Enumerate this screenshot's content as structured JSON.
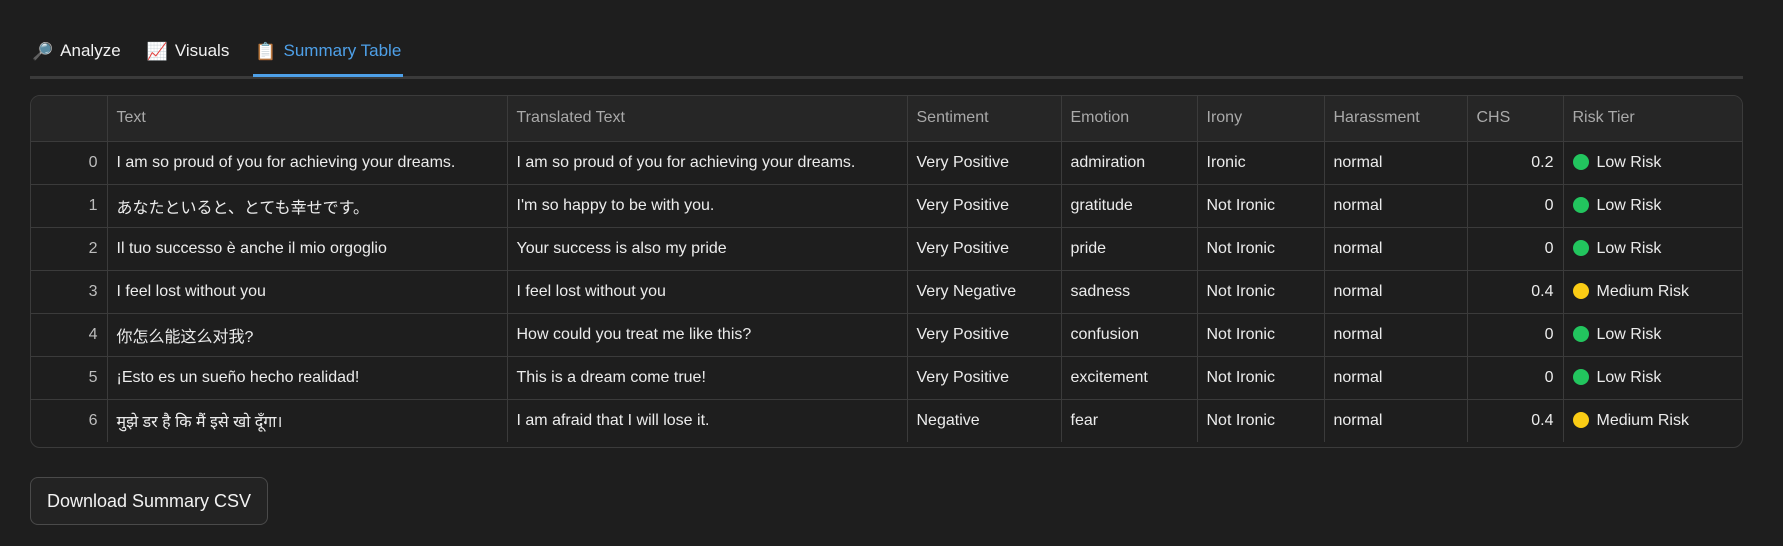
{
  "tabs": [
    {
      "label": "Analyze",
      "icon": "🔎",
      "active": false
    },
    {
      "label": "Visuals",
      "icon": "📈",
      "active": false
    },
    {
      "label": "Summary Table",
      "icon": "📋",
      "active": true
    }
  ],
  "table": {
    "columns": [
      "",
      "Text",
      "Translated Text",
      "Sentiment",
      "Emotion",
      "Irony",
      "Harassment",
      "CHS",
      "Risk Tier"
    ],
    "rows": [
      {
        "index": "0",
        "text": "I am so proud of you for achieving your dreams.",
        "translated": "I am so proud of you for achieving your dreams.",
        "sentiment": "Very Positive",
        "emotion": "admiration",
        "irony": "Ironic",
        "harassment": "normal",
        "chs": "0.2",
        "risk": "Low Risk",
        "risk_color": "#22c55e"
      },
      {
        "index": "1",
        "text": "あなたといると、とても幸せです。",
        "translated": "I'm so happy to be with you.",
        "sentiment": "Very Positive",
        "emotion": "gratitude",
        "irony": "Not Ironic",
        "harassment": "normal",
        "chs": "0",
        "risk": "Low Risk",
        "risk_color": "#22c55e"
      },
      {
        "index": "2",
        "text": "Il tuo successo è anche il mio orgoglio",
        "translated": "Your success is also my pride",
        "sentiment": "Very Positive",
        "emotion": "pride",
        "irony": "Not Ironic",
        "harassment": "normal",
        "chs": "0",
        "risk": "Low Risk",
        "risk_color": "#22c55e"
      },
      {
        "index": "3",
        "text": "I feel lost without you",
        "translated": "I feel lost without you",
        "sentiment": "Very Negative",
        "emotion": "sadness",
        "irony": "Not Ironic",
        "harassment": "normal",
        "chs": "0.4",
        "risk": "Medium Risk",
        "risk_color": "#facc15"
      },
      {
        "index": "4",
        "text": "你怎么能这么对我?",
        "translated": "How could you treat me like this?",
        "sentiment": "Very Positive",
        "emotion": "confusion",
        "irony": "Not Ironic",
        "harassment": "normal",
        "chs": "0",
        "risk": "Low Risk",
        "risk_color": "#22c55e"
      },
      {
        "index": "5",
        "text": "¡Esto es un sueño hecho realidad!",
        "translated": "This is a dream come true!",
        "sentiment": "Very Positive",
        "emotion": "excitement",
        "irony": "Not Ironic",
        "harassment": "normal",
        "chs": "0",
        "risk": "Low Risk",
        "risk_color": "#22c55e"
      },
      {
        "index": "6",
        "text": "मुझे डर है कि मैं इसे खो दूँगा।",
        "translated": "I am afraid that I will lose it.",
        "sentiment": "Negative",
        "emotion": "fear",
        "irony": "Not Ironic",
        "harassment": "normal",
        "chs": "0.4",
        "risk": "Medium Risk",
        "risk_color": "#facc15"
      }
    ]
  },
  "download_button": {
    "label": "Download Summary CSV"
  }
}
